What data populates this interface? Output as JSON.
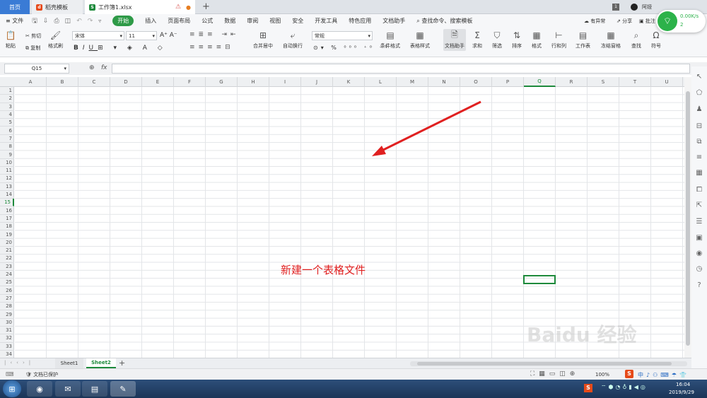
{
  "tabs": {
    "home": "首页",
    "template": "稻壳模板",
    "doc": "工作簿1.xlsx"
  },
  "menu": {
    "file": "文件",
    "start": "开始",
    "items": [
      "插入",
      "页面布局",
      "公式",
      "数据",
      "审阅",
      "视图",
      "安全",
      "开发工具",
      "特色应用",
      "文档助手"
    ],
    "search": "查找命令、搜索模板",
    "abnormal": "有异常",
    "share": "分享",
    "annotate": "批注"
  },
  "ribbon": {
    "paste": "粘贴",
    "cut": "剪切",
    "copy": "复制",
    "format_painter": "格式刷",
    "font": "宋体",
    "size": "11",
    "merge": "合并居中",
    "wrap": "自动换行",
    "number_format": "常规",
    "cond_format": "条件格式",
    "table_style": "表格样式",
    "doc_helper": "文档助手",
    "sum": "求和",
    "filter": "筛选",
    "sort": "排序",
    "format": "格式",
    "rowcol": "行和列",
    "worksheet": "工作表",
    "freeze": "冻结窗格",
    "find": "查找",
    "symbol": "符号"
  },
  "formula": {
    "cell_ref": "Q15",
    "fx": "fx"
  },
  "columns": [
    "A",
    "B",
    "C",
    "D",
    "E",
    "F",
    "G",
    "H",
    "I",
    "J",
    "K",
    "L",
    "M",
    "N",
    "O",
    "P",
    "Q",
    "R",
    "S",
    "T",
    "U"
  ],
  "rows": [
    "1",
    "2",
    "3",
    "4",
    "5",
    "6",
    "7",
    "8",
    "9",
    "10",
    "11",
    "12",
    "13",
    "14",
    "15",
    "16",
    "17",
    "18",
    "19",
    "20",
    "21",
    "22",
    "23",
    "24",
    "25",
    "26",
    "27",
    "28",
    "29",
    "30",
    "31",
    "32",
    "33",
    "34"
  ],
  "selected_cell": "Q15",
  "annotation": "新建一个表格文件",
  "sheets": [
    "Sheet1",
    "Sheet2"
  ],
  "active_sheet": "Sheet2",
  "status": {
    "protected": "文档已保护",
    "zoom": "100%"
  },
  "network": {
    "speed": "0.00K/s",
    "count": "2"
  },
  "clock": {
    "time": "16:04",
    "date": "2019/9/29"
  },
  "watermark": "Baidu 经验",
  "colors": {
    "accent": "#1e8a3c",
    "annotation": "#e02020",
    "tab_home": "#3a7bd5"
  }
}
